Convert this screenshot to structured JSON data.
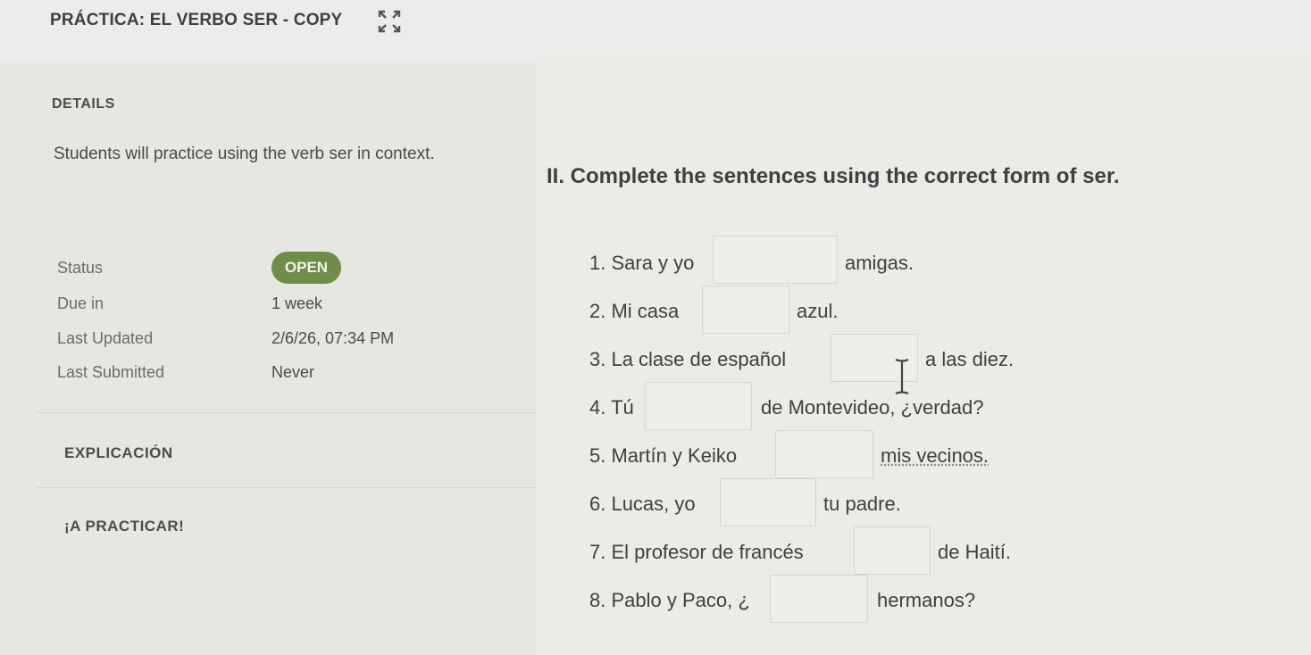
{
  "header": {
    "title": "PRÁCTICA: EL VERBO SER - COPY",
    "expand_icon": "expand-icon"
  },
  "details": {
    "heading": "DETAILS",
    "description": "Students will practice using the verb ser in context.",
    "status_key": "Status",
    "status_value": "OPEN",
    "due_key": "Due in",
    "due_value": "1 week",
    "updated_key": "Last Updated",
    "updated_value": "2/6/26, 07:34 PM",
    "submitted_key": "Last Submitted",
    "submitted_value": "Never",
    "status_color": "#6e8c4a"
  },
  "nav": {
    "explicacion": "EXPLICACIÓN",
    "practicar": "¡A PRACTICAR!"
  },
  "exercise": {
    "instructions": "II. Complete the sentences using the correct form of ser.",
    "questions": [
      {
        "before": "1. Sara y yo",
        "after": "amigas."
      },
      {
        "before": "2. Mi casa",
        "after": "azul."
      },
      {
        "before": "3. La clase de español",
        "after": "a las diez."
      },
      {
        "before": "4. Tú",
        "after": "de Montevideo, ¿verdad?"
      },
      {
        "before": "5. Martín y Keiko",
        "after": "mis vecinos."
      },
      {
        "before": "6. Lucas, yo",
        "after": "tu padre."
      },
      {
        "before": "7. El profesor de francés",
        "after": "de Haití."
      },
      {
        "before": "8. Pablo y Paco, ¿",
        "after": "hermanos?"
      }
    ]
  }
}
